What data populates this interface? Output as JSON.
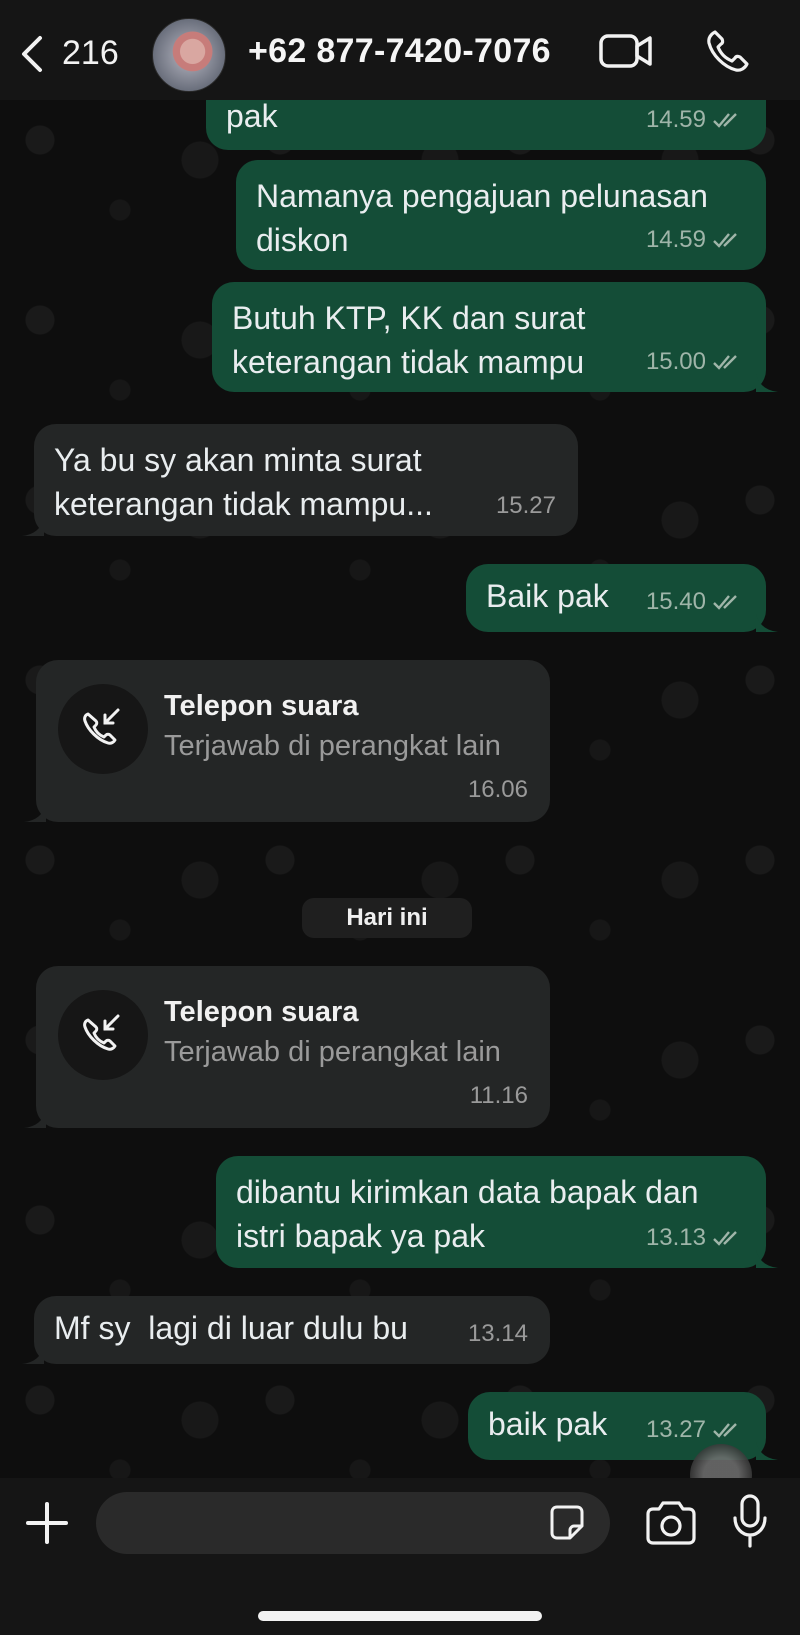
{
  "header": {
    "back_count": "216",
    "contact_name": "+62 877-7420-7076"
  },
  "messages": [
    {
      "text": "pak",
      "time": "14.59"
    },
    {
      "text": "Namanya pengajuan pelunasan diskon",
      "line1": "Namanya pengajuan pelunasan",
      "line2": "diskon",
      "time": "14.59"
    },
    {
      "line1": "Butuh KTP, KK dan surat",
      "line2": "keterangan tidak mampu",
      "time": "15.00"
    },
    {
      "line1": "Ya bu sy akan minta surat",
      "line2": "keterangan tidak mampu...",
      "time": "15.27"
    },
    {
      "text": "Baik pak",
      "time": "15.40"
    },
    {
      "line1": "dibantu kirimkan data bapak dan",
      "line2": "istri bapak ya pak",
      "time": "13.13"
    },
    {
      "text": "Mf sy  lagi di luar dulu bu",
      "time": "13.14"
    },
    {
      "text": "baik pak",
      "time": "13.27"
    }
  ],
  "calls": [
    {
      "title": "Telepon suara",
      "subtitle": "Terjawab di perangkat lain",
      "time": "16.06"
    },
    {
      "title": "Telepon suara",
      "subtitle": "Terjawab di perangkat lain",
      "time": "11.16"
    }
  ],
  "date_separator": "Hari ini",
  "composer": {
    "placeholder": ""
  },
  "colors": {
    "outgoing_bubble": "#144d37",
    "incoming_bubble": "#242626",
    "tick": "#9fb5a9"
  },
  "icons": [
    "back-chevron-icon",
    "video-call-icon",
    "phone-icon",
    "incoming-call-icon",
    "plus-icon",
    "sticker-icon",
    "camera-icon",
    "mic-icon",
    "double-tick-icon"
  ]
}
